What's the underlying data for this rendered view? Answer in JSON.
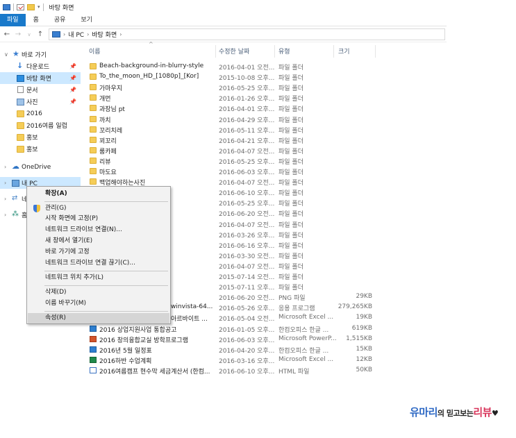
{
  "window": {
    "title": "바탕 화면"
  },
  "ribbon": {
    "tabs": [
      "파일",
      "홈",
      "공유",
      "보기"
    ]
  },
  "address": {
    "crumbs": [
      "내 PC",
      "바탕 화면"
    ]
  },
  "sidebar": {
    "quick_access": "바로 가기",
    "items": [
      "다운로드",
      "바탕 화면",
      "문서",
      "사진",
      "2016",
      "2016여름 일렵",
      "홍보",
      "홍보"
    ],
    "onedrive": "OneDrive",
    "this_pc": "내 PC",
    "network_partial": "네",
    "homegroup_partial": "홈"
  },
  "columns": {
    "name": "이름",
    "date": "수정한 날짜",
    "type": "유형",
    "size": "크기"
  },
  "files": [
    {
      "name": "Beach-background-in-blurry-style",
      "date": "2016-04-01 오전...",
      "type": "파일 폴더",
      "size": "",
      "icon": "folder"
    },
    {
      "name": "To_the_moon_HD_[1080p]_[Kor]",
      "date": "2015-10-08 오후...",
      "type": "파일 폴더",
      "size": "",
      "icon": "folder"
    },
    {
      "name": "가마우지",
      "date": "2016-05-25 오후...",
      "type": "파일 폴더",
      "size": "",
      "icon": "folder"
    },
    {
      "name": "개먼",
      "date": "2016-01-26 오후...",
      "type": "파일 폴더",
      "size": "",
      "icon": "folder"
    },
    {
      "name": "과장님 pt",
      "date": "2016-04-01 오후...",
      "type": "파일 폴더",
      "size": "",
      "icon": "folder"
    },
    {
      "name": "까치",
      "date": "2016-04-29 오후...",
      "type": "파일 폴더",
      "size": "",
      "icon": "folder"
    },
    {
      "name": "꼬리치레",
      "date": "2016-05-11 오후...",
      "type": "파일 폴더",
      "size": "",
      "icon": "folder"
    },
    {
      "name": "꾀꼬리",
      "date": "2016-04-21 오후...",
      "type": "파일 폴더",
      "size": "",
      "icon": "folder"
    },
    {
      "name": "룸카페",
      "date": "2016-04-07 오전...",
      "type": "파일 폴더",
      "size": "",
      "icon": "folder"
    },
    {
      "name": "리뷰",
      "date": "2016-05-25 오후...",
      "type": "파일 폴더",
      "size": "",
      "icon": "folder"
    },
    {
      "name": "마도요",
      "date": "2016-06-03 오후...",
      "type": "파일 폴더",
      "size": "",
      "icon": "folder"
    },
    {
      "name": "백업해야하는사진",
      "date": "2016-04-07 오전...",
      "type": "파일 폴더",
      "size": "",
      "icon": "folder"
    },
    {
      "name": "",
      "date": "2016-06-10 오후...",
      "type": "파일 폴더",
      "size": "",
      "icon": ""
    },
    {
      "name": "",
      "date": "2016-05-25 오후...",
      "type": "파일 폴더",
      "size": "",
      "icon": ""
    },
    {
      "name": "",
      "date": "2016-06-20 오전...",
      "type": "파일 폴더",
      "size": "",
      "icon": ""
    },
    {
      "name": "",
      "date": "2016-04-07 오전...",
      "type": "파일 폴더",
      "size": "",
      "icon": ""
    },
    {
      "name": "",
      "date": "2016-03-26 오후...",
      "type": "파일 폴더",
      "size": "",
      "icon": ""
    },
    {
      "name": "",
      "date": "2016-06-16 오후...",
      "type": "파일 폴더",
      "size": "",
      "icon": ""
    },
    {
      "name": "",
      "date": "2016-03-30 오전...",
      "type": "파일 폴더",
      "size": "",
      "icon": ""
    },
    {
      "name": "",
      "date": "2016-04-07 오전...",
      "type": "파일 폴더",
      "size": "",
      "icon": ""
    },
    {
      "name": "",
      "date": "2015-07-14 오전...",
      "type": "파일 폴더",
      "size": "",
      "icon": ""
    },
    {
      "name": "",
      "date": "2015-07-11 오후...",
      "type": "파일 폴더",
      "size": "",
      "icon": ""
    },
    {
      "name": "",
      "date": "2016-06-20 오전...",
      "type": "PNG 파일",
      "size": "29KB",
      "icon": ""
    },
    {
      "name": "winvista-64...",
      "date": "2016-05-26 오후...",
      "type": "응용 프로그램",
      "size": "279,265KB",
      "icon": ""
    },
    {
      "name": "아르바이트 ...",
      "date": "2016-05-04 오전...",
      "type": "Microsoft Excel ...",
      "size": "19KB",
      "icon": ""
    },
    {
      "name": "2016 상업지원사업 통합공고",
      "date": "2016-01-05 오후...",
      "type": "한컴오피스 한글 ...",
      "size": "619KB",
      "icon": "hwp"
    },
    {
      "name": "2016 창의융합교실 방학프로그램",
      "date": "2016-06-03 오후...",
      "type": "Microsoft PowerP...",
      "size": "1,515KB",
      "icon": "ppt"
    },
    {
      "name": "2016년 5월 일정표",
      "date": "2016-04-20 오후...",
      "type": "한컴오피스 한글 ...",
      "size": "15KB",
      "icon": "hwp"
    },
    {
      "name": "2016하반 수업계획",
      "date": "2016-03-16 오후...",
      "type": "Microsoft Excel ...",
      "size": "12KB",
      "icon": "xls"
    },
    {
      "name": "2016여름캠프 현수막 세금계산서 (한컴...",
      "date": "2016-06-10 오후...",
      "type": "HTML 파일",
      "size": "50KB",
      "icon": "html"
    }
  ],
  "context_menu": {
    "expand": "확장(A)",
    "manage": "관리(G)",
    "pin_start": "시작 화면에 고정(P)",
    "map_drive": "네트워크 드라이브 연결(N)...",
    "open_new_window": "새 창에서 열기(E)",
    "pin_quick": "바로 가기에 고정",
    "disconnect_drive": "네트워크 드라이브 연결 끊기(C)...",
    "add_network_location": "네트워크 위치 추가(L)",
    "delete": "삭제(D)",
    "rename": "이름 바꾸기(M)",
    "properties": "속성(R)"
  },
  "watermark": {
    "part1": "유마리",
    "part2": "의 믿고보는",
    "part3": "리뷰",
    "heart": "♥"
  }
}
